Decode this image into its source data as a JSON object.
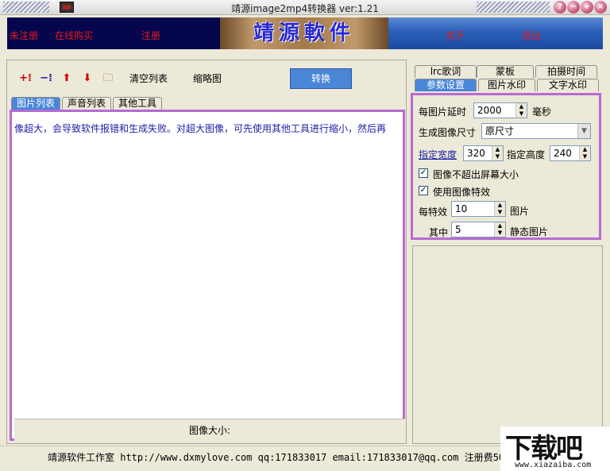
{
  "window": {
    "title": "靖源image2mp4转换器 ver:1.21",
    "controls": [
      "?",
      "−",
      "+",
      "×"
    ]
  },
  "banner": {
    "logo_text": "靖源軟件",
    "links": {
      "unregistered": "未注册",
      "buy_online": "在线购买",
      "register": "注册",
      "about": "关于",
      "exit": "退出"
    }
  },
  "toolbar": {
    "icons": [
      "add-icon",
      "remove-icon",
      "move-up-icon",
      "move-down-icon",
      "folder-icon"
    ],
    "clear_list": "清空列表",
    "thumbnail": "缩略图",
    "convert": "转换"
  },
  "left_tabs": [
    "图片列表",
    "声音列表",
    "其他工具"
  ],
  "image_list": {
    "scroll_message": "像超大，会导致软件报错和生成失败。对超大图像，可先使用其他工具进行缩小，然后再",
    "size_label": "图像大小:"
  },
  "right_tabs": {
    "row1": [
      "lrc歌词",
      "蒙板",
      "拍摄时间"
    ],
    "row2": [
      "参数设置",
      "图片水印",
      "文字水印"
    ]
  },
  "settings": {
    "delay_label": "每图片延时",
    "delay_value": "2000",
    "delay_unit": "毫秒",
    "size_label": "生成图像尺寸",
    "size_value": "原尺寸",
    "width_label": "指定宽度",
    "width_value": "320",
    "height_label": "指定高度",
    "height_value": "240",
    "no_exceed_label": "图像不超出屏幕大小",
    "no_exceed_checked": true,
    "effects_label": "使用图像特效",
    "effects_checked": true,
    "per_effect_label": "每特效",
    "per_effect_value": "10",
    "per_effect_unit": "图片",
    "of_which_label": "其中",
    "of_which_value": "5",
    "of_which_unit": "静态图片"
  },
  "status": {
    "text": "靖源软件工作室 http://www.dxmylove.com qq:171833017 email:171833017@qq.com 注册费50"
  },
  "watermark": {
    "main": "下载吧",
    "sub": "www.xiazaiba.com"
  },
  "colors": {
    "accent_blue": "#4a86d8",
    "highlight_border": "#b86ad2",
    "banner_link_red": "#e81b1b"
  }
}
